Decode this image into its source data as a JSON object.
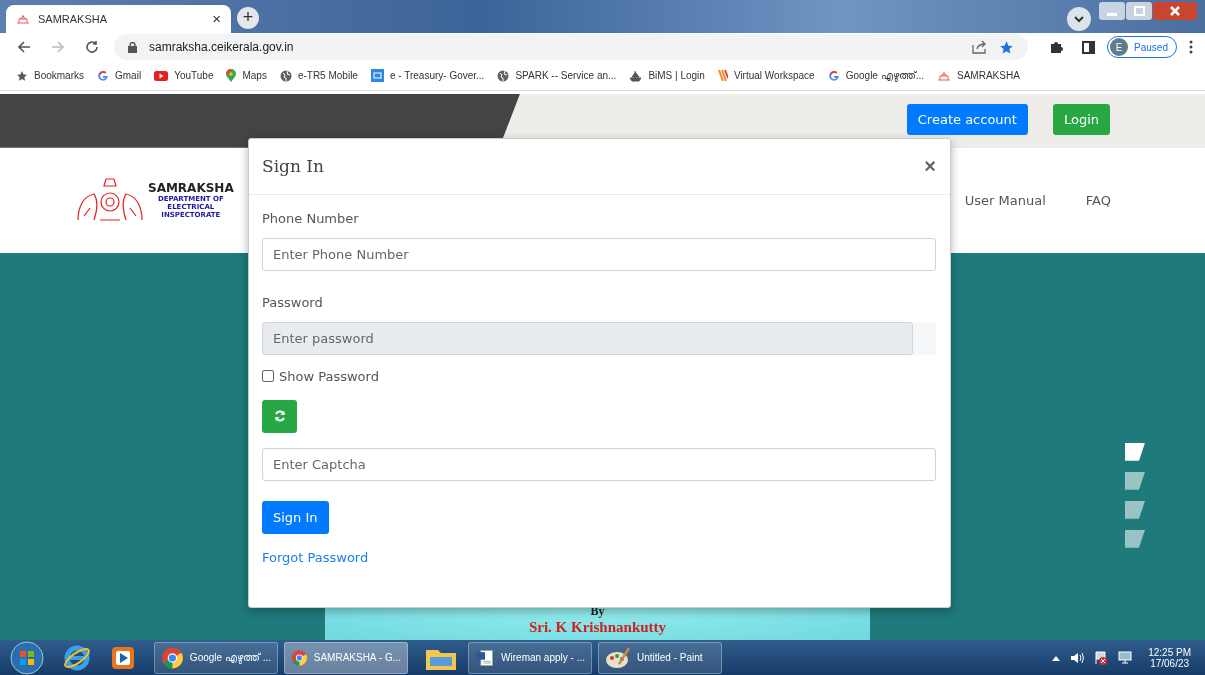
{
  "browser": {
    "tabs": [
      {
        "title": "SAMRAKSHA",
        "close": "×",
        "selected": true
      }
    ],
    "new_tab": "+",
    "url": "samraksha.ceikerala.gov.in",
    "profile": {
      "initial": "E",
      "status": "Paused"
    },
    "bookmarks": [
      {
        "label": "Bookmarks",
        "kind": "star"
      },
      {
        "label": "Gmail",
        "kind": "google"
      },
      {
        "label": "YouTube",
        "kind": "youtube"
      },
      {
        "label": "Maps",
        "kind": "maps"
      },
      {
        "label": "e-TR5 Mobile",
        "kind": "globe"
      },
      {
        "label": "e - Treasury- Gover...",
        "kind": "etr"
      },
      {
        "label": "SPARK -- Service an...",
        "kind": "globe"
      },
      {
        "label": "BiMS | Login",
        "kind": "bims"
      },
      {
        "label": "Virtual Workspace",
        "kind": "vw"
      },
      {
        "label": "Google എഴുത്ത്...",
        "kind": "google"
      },
      {
        "label": "SAMRAKSHA",
        "kind": "emblem"
      }
    ]
  },
  "header": {
    "buttons": [
      {
        "label": "Create account",
        "kind": "primary"
      },
      {
        "label": "Login",
        "kind": "success"
      }
    ]
  },
  "logo": {
    "title": "SAMRAKSHA",
    "lines": [
      "DEPARTMENT OF",
      "ELECTRICAL",
      "INSPECTORATE"
    ]
  },
  "nav": [
    "User Manual",
    "FAQ"
  ],
  "banner": {
    "by": "By",
    "name": "Sri. K Krishnankutty"
  },
  "carousel": [
    {
      "selected": true
    },
    {
      "selected": false
    },
    {
      "selected": false
    },
    {
      "selected": false
    }
  ],
  "modal": {
    "title": "Sign In",
    "close": "×",
    "phone_label": "Phone Number",
    "phone": {
      "placeholder": "Enter Phone Number"
    },
    "password_label": "Password",
    "password": {
      "placeholder": "Enter password",
      "disabled": true
    },
    "show_password": {
      "label": "Show Password",
      "checked": false
    },
    "captcha": {
      "placeholder": "Enter Captcha"
    },
    "submit": "Sign In",
    "forgot": "Forgot Password"
  },
  "taskbar": {
    "items": [
      {
        "kind": "start"
      },
      {
        "kind": "ie"
      },
      {
        "kind": "media"
      },
      {
        "kind": "chrome",
        "label": "Google എഴുത്ത് ...",
        "selected": false
      },
      {
        "kind": "chrome",
        "label": "SAMRAKSHA - G...",
        "selected": true
      },
      {
        "kind": "explorer"
      },
      {
        "kind": "word",
        "label": "Wireman apply - ...",
        "selected": false
      },
      {
        "kind": "paint",
        "label": "Untitled - Paint",
        "selected": false
      }
    ],
    "time": "12:25 PM",
    "date": "17/06/23"
  }
}
